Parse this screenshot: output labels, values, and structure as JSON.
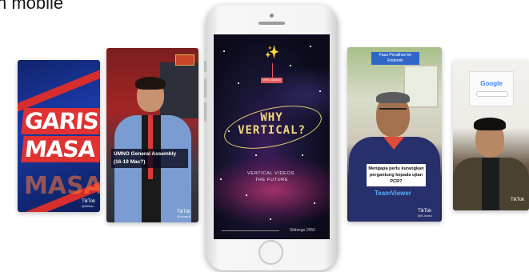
{
  "page": {
    "title": "n mobile"
  },
  "cards": {
    "garis_masa": {
      "words": [
        "GARIS",
        "MASA"
      ],
      "ghost_text": "MASA",
      "watermark": "TikTok",
      "handle": "@ditikan"
    },
    "umno": {
      "caption_line1": "UMNO General Assembly",
      "caption_line2": "(16-19 Mac?)",
      "sign": "",
      "watermark": "TikTok",
      "handle": "@zizadoll"
    },
    "vertical": {
      "tag": "WHO AWANI",
      "headline_line1": "WHY",
      "headline_line2": "VERTICAL?",
      "sub_line1": "VERTICAL VIDEOS.",
      "sub_line2": "THE FUTURE",
      "handle": "Slideego 2050"
    },
    "kj": {
      "top_caption": "Fasa Peralihan ke Endemik",
      "caption": "Mengapa perlu kurangkan pergantung kepada ujian PCR?",
      "brand": "TeamViewer",
      "watermark": "TikTok",
      "handle": "@KJoned"
    },
    "google": {
      "search_logo": "Google",
      "watermark": "TikTok"
    }
  },
  "colors": {
    "accent_red": "#e03232",
    "headline_gold": "#f1d77a",
    "caption_blue": "#2f66c8"
  }
}
